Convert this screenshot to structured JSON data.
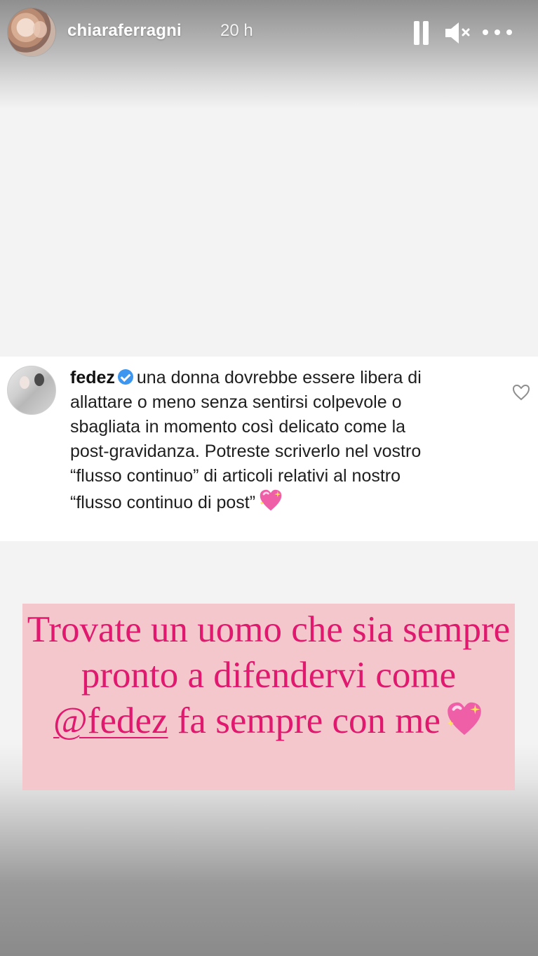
{
  "header": {
    "username": "chiaraferragni",
    "time": "20 h"
  },
  "comment": {
    "author": "fedez",
    "text": "una donna dovrebbe essere libera di allattare o meno senza sentirsi colpevole o sbagliata in momento così delicato come la post-gravidanza. Potreste scriverlo nel vostro “flusso continuo” di articoli relativi al nostro “flusso continuo di post”"
  },
  "caption": {
    "before": "Trovate un uomo che sia sempre pronto a difendervi come ",
    "mention": "@fedez",
    "after": " fa sempre con me"
  },
  "colors": {
    "quote_text": "#e0196e",
    "quote_background": "#f4c7cd",
    "verified": "#3d97f0"
  },
  "icons": [
    "pause-icon",
    "mute-icon",
    "more-icon",
    "verified-icon",
    "heart-icon",
    "sparkling-heart-icon"
  ]
}
